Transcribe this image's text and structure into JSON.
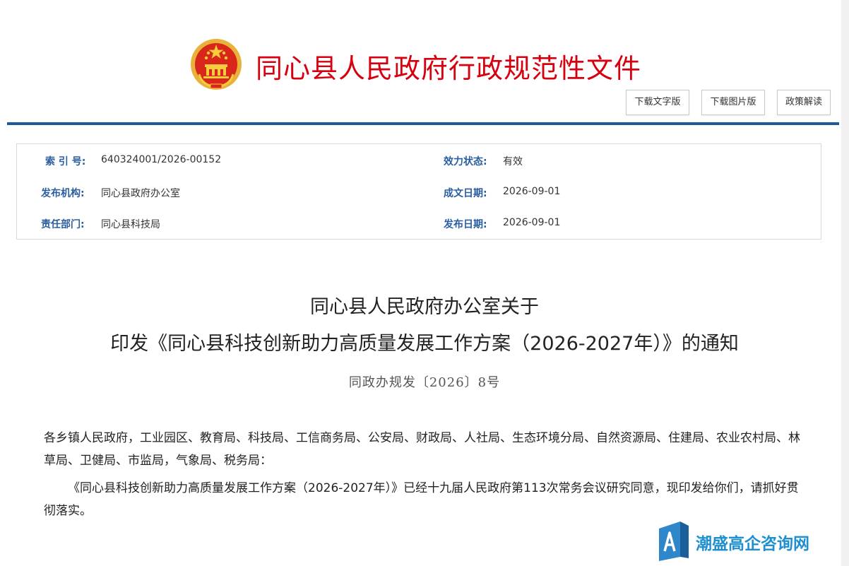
{
  "header": {
    "site_title": "同心县人民政府行政规范性文件",
    "buttons": {
      "download_text": "下载文字版",
      "download_image": "下载图片版",
      "policy_interpretation": "政策解读"
    }
  },
  "meta": {
    "index_label": "索 引 号:",
    "index_value": "640324001/2026-00152",
    "status_label": "效力状态:",
    "status_value": "有效",
    "publisher_label": "发布机构:",
    "publisher_value": "同心县政府办公室",
    "written_date_label": "成文日期:",
    "written_date_value": "2026-09-01",
    "dept_label": "责任部门:",
    "dept_value": "同心县科技局",
    "publish_date_label": "发布日期:",
    "publish_date_value": "2026-09-01"
  },
  "document": {
    "title_line1": "同心县人民政府办公室关于",
    "title_line2": "印发《同心县科技创新助力高质量发展工作方案（2026-2027年）》的通知",
    "doc_number": "同政办规发〔2026〕8号",
    "recipients": "各乡镇人民政府，工业园区、教育局、科技局、工信商务局、公安局、财政局、人社局、生态环境分局、自然资源局、住建局、农业农村局、林草局、卫健局、市监局，气象局、税务局：",
    "body": "《同心县科技创新助力高质量发展工作方案（2026-2027年）》已经十九届人民政府第113次常务会议研究同意，现印发给你们，请抓好贯彻落实。"
  },
  "watermark": {
    "text": "潮盛高企咨询网"
  },
  "colors": {
    "title_red": "#d7000f",
    "label_blue": "#2a5e9e",
    "rule_blue": "#1d5a9b",
    "watermark_blue": "#1e8fd0"
  }
}
